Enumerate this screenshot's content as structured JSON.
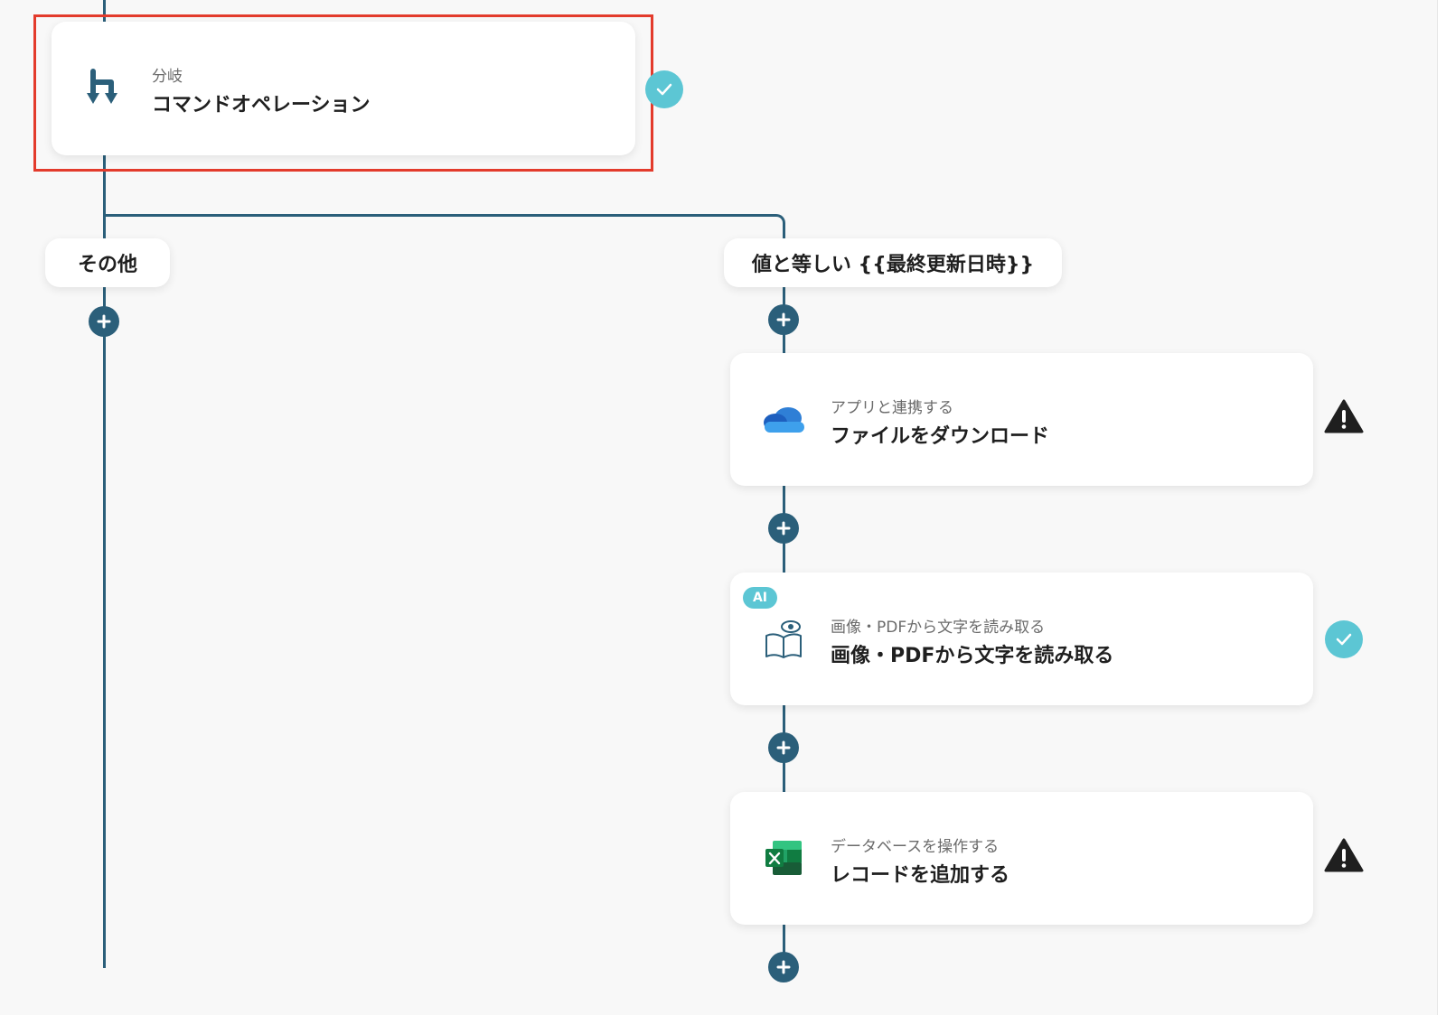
{
  "branch_card": {
    "category": "分岐",
    "title": "コマンドオペレーション"
  },
  "branches": {
    "left_label": "その他",
    "right_label": "値と等しい {{最終更新日時}}"
  },
  "steps": [
    {
      "category": "アプリと連携する",
      "title": "ファイルをダウンロード",
      "status": "warning",
      "icon": "onedrive-icon"
    },
    {
      "category": "画像・PDFから文字を読み取る",
      "title": "画像・PDFから文字を読み取る",
      "status": "done",
      "icon": "ocr-book-eye-icon",
      "badge": "AI"
    },
    {
      "category": "データベースを操作する",
      "title": "レコードを追加する",
      "status": "warning",
      "icon": "excel-icon"
    }
  ],
  "colors": {
    "connector": "#2b5f7a",
    "check": "#5cc6d4",
    "highlight": "#e33b2c",
    "warning": "#1f1f1f"
  }
}
